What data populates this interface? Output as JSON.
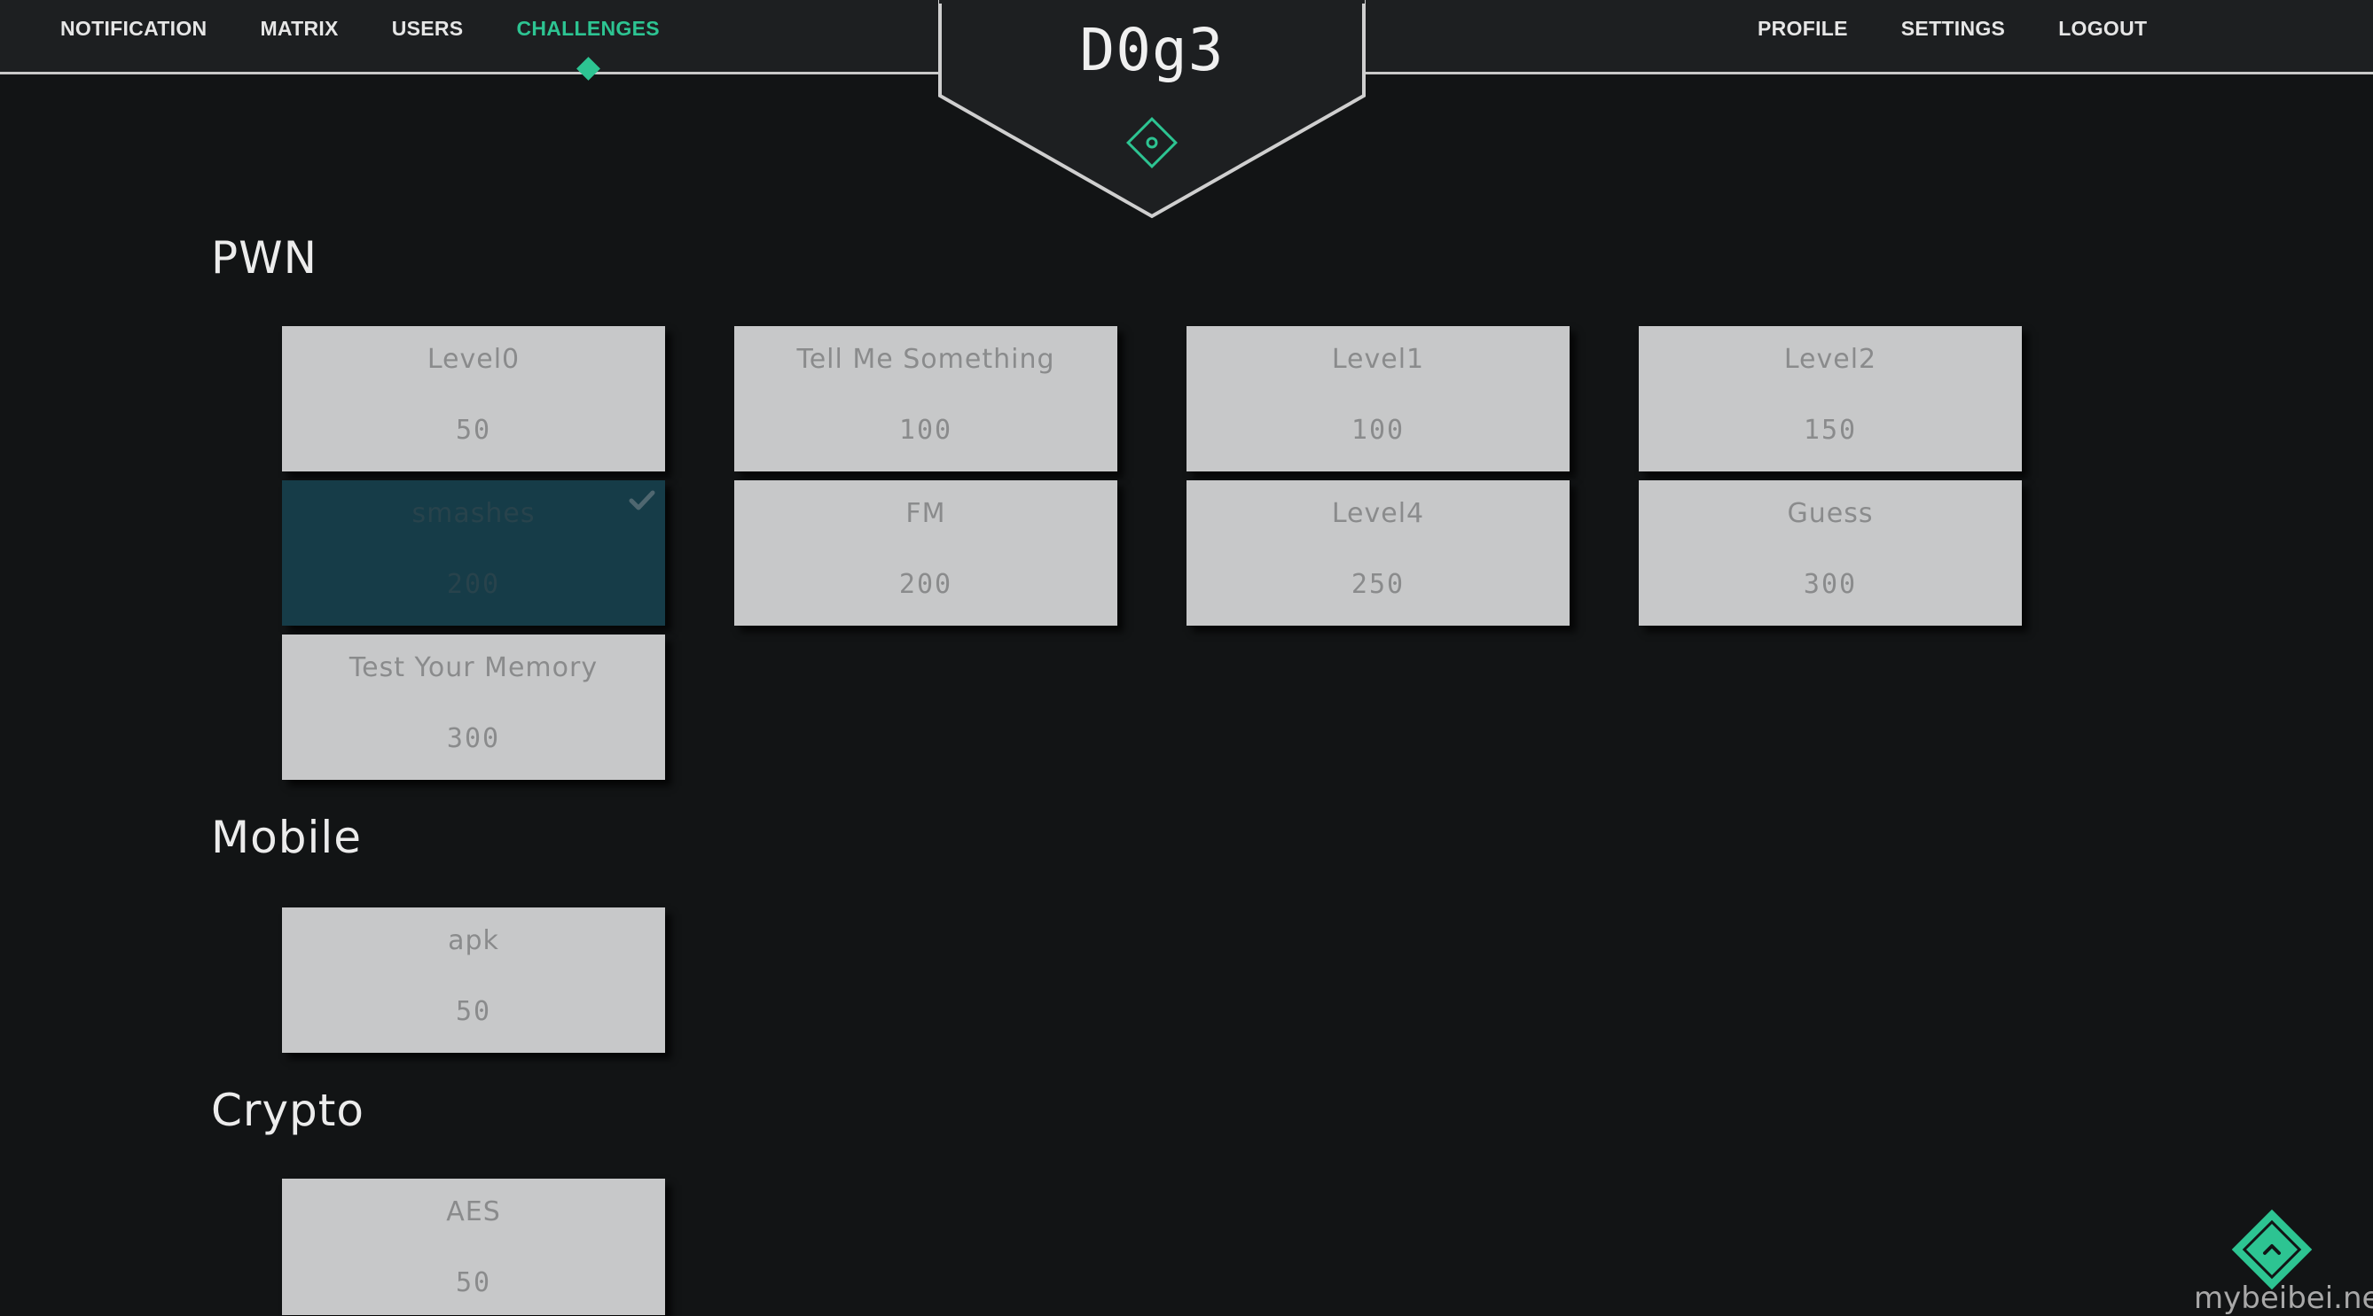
{
  "nav": {
    "left": [
      "NOTIFICATION",
      "MATRIX",
      "USERS",
      "CHALLENGES"
    ],
    "active": "CHALLENGES",
    "right": [
      "PROFILE",
      "SETTINGS",
      "LOGOUT"
    ]
  },
  "logo": {
    "text": "D0g3",
    "icon": "diamond-target-icon"
  },
  "sections": {
    "pwn": {
      "title": "PWN",
      "cards": [
        {
          "name": "Level0",
          "points": "50",
          "solved": false
        },
        {
          "name": "Tell Me Something",
          "points": "100",
          "solved": false
        },
        {
          "name": "Level1",
          "points": "100",
          "solved": false
        },
        {
          "name": "Level2",
          "points": "150",
          "solved": false
        },
        {
          "name": "smashes",
          "points": "200",
          "solved": true
        },
        {
          "name": "FM",
          "points": "200",
          "solved": false
        },
        {
          "name": "Level4",
          "points": "250",
          "solved": false
        },
        {
          "name": "Guess",
          "points": "300",
          "solved": false
        },
        {
          "name": "Test Your Memory",
          "points": "300",
          "solved": false
        }
      ]
    },
    "mobile": {
      "title": "Mobile",
      "cards": [
        {
          "name": "apk",
          "points": "50",
          "solved": false
        }
      ]
    },
    "crypto": {
      "title": "Crypto",
      "cards": [
        {
          "name": "AES",
          "points": "50",
          "solved": false
        }
      ]
    }
  },
  "watermark": "mybeibei.net",
  "colors": {
    "accent": "#2dc492",
    "background": "#121415",
    "topbar": "#1d1f21",
    "card": "#c7c8c9",
    "card_solved": "#163c48"
  },
  "icons": {
    "solved": "checkmark-icon",
    "scroll_top": "chevron-up-icon"
  }
}
